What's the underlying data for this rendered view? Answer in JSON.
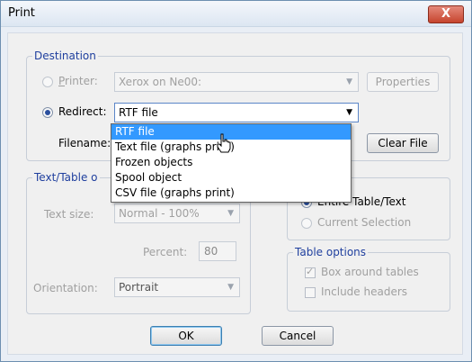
{
  "window": {
    "title": "Print",
    "close_label": "X"
  },
  "destination": {
    "legend": "Destination",
    "printer_label": "Printer:",
    "printer_value": "Xerox on Ne00:",
    "properties_button": "Properties",
    "redirect_label": "Redirect:",
    "redirect_value": "RTF file",
    "filename_label": "Filename:",
    "clear_file_button": "Clear File",
    "selected_radio": "redirect"
  },
  "dropdown": {
    "options": [
      "RTF file",
      "Text file (graphs print)",
      "Frozen objects",
      "Spool object",
      "CSV file (graphs print)"
    ],
    "selected": "RTF file"
  },
  "text_table_options": {
    "legend": "Text/Table o",
    "text_size_label": "Text size:",
    "text_size_value": "Normal - 100%",
    "percent_label": "Percent:",
    "percent_value": "80",
    "orientation_label": "Orientation:",
    "orientation_value": "Portrait"
  },
  "range": {
    "legend_tail": "e",
    "entire_label": "Entire Table/Text",
    "current_label": "Current Selection",
    "selected": "entire"
  },
  "table_options": {
    "legend": "Table options",
    "box_label": "Box around tables",
    "box_checked": true,
    "headers_label": "Include headers",
    "headers_checked": false
  },
  "buttons": {
    "ok": "OK",
    "cancel": "Cancel"
  }
}
